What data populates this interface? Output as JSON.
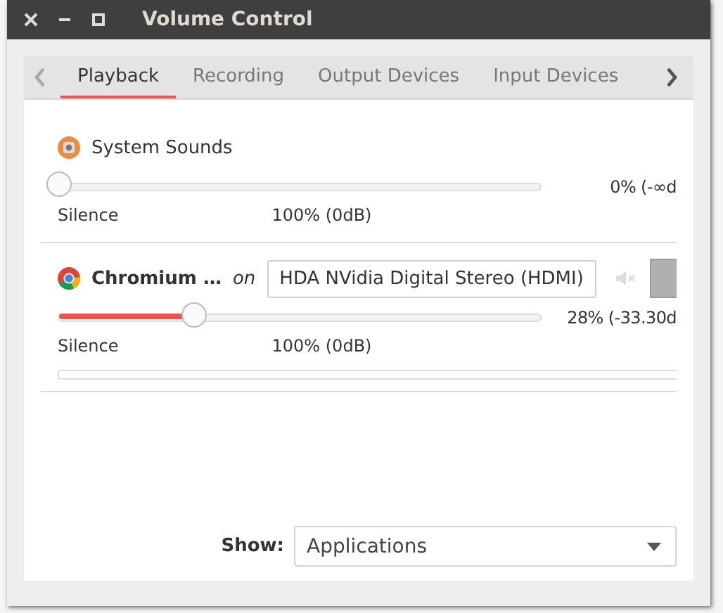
{
  "window": {
    "title": "Volume Control"
  },
  "tabs": [
    {
      "label": "Playback",
      "selected": true
    },
    {
      "label": "Recording",
      "selected": false
    },
    {
      "label": "Output Devices",
      "selected": false
    },
    {
      "label": "Input Devices",
      "selected": false
    }
  ],
  "streams": [
    {
      "kind": "system",
      "name": "System Sounds",
      "level": 0,
      "reading": "0% (-∞d",
      "scale_min": "Silence",
      "scale_mid": "100% (0dB)"
    },
    {
      "kind": "app",
      "name": "Chromium …",
      "connector": "on",
      "device": "HDA NVidia Digital Stereo (HDMI)",
      "level": 0.28,
      "reading": "28% (-33.30d",
      "scale_min": "Silence",
      "scale_mid": "100% (0dB)"
    }
  ],
  "show": {
    "label": "Show:",
    "value": "Applications"
  }
}
